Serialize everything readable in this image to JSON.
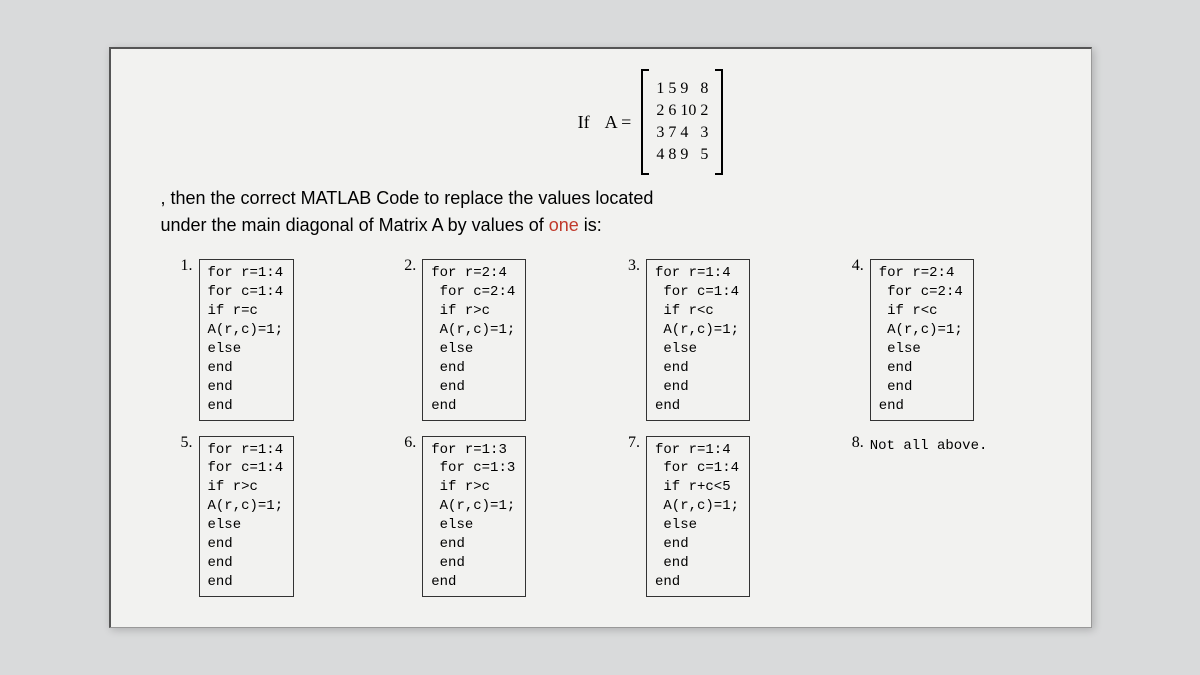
{
  "matrix": {
    "if_label": "If",
    "A_label": "A =",
    "rows": [
      [
        "1",
        "5",
        "9",
        "8"
      ],
      [
        "2",
        "6",
        "10",
        "2"
      ],
      [
        "3",
        "7",
        "4",
        "3"
      ],
      [
        "4",
        "8",
        "9",
        "5"
      ]
    ]
  },
  "question": {
    "line1_prefix": ", then the correct MATLAB Code to replace the values located",
    "line2_prefix": "under the main diagonal of Matrix A by values of ",
    "highlight": "one",
    "line2_suffix": " is:"
  },
  "options": [
    {
      "num": "1.",
      "code": "for r=1:4\nfor c=1:4\nif r=c\nA(r,c)=1;\nelse\nend\nend\nend"
    },
    {
      "num": "2.",
      "code": "for r=2:4\n for c=2:4\n if r>c\n A(r,c)=1;\n else\n end\n end\nend"
    },
    {
      "num": "3.",
      "code": "for r=1:4\n for c=1:4\n if r<c\n A(r,c)=1;\n else\n end\n end\nend"
    },
    {
      "num": "4.",
      "code": "for r=2:4\n for c=2:4\n if r<c\n A(r,c)=1;\n else\n end\n end\nend"
    },
    {
      "num": "5.",
      "code": "for r=1:4\nfor c=1:4\nif r>c\nA(r,c)=1;\nelse\nend\nend\nend"
    },
    {
      "num": "6.",
      "code": "for r=1:3\n for c=1:3\n if r>c\n A(r,c)=1;\n else\n end\n end\nend"
    },
    {
      "num": "7.",
      "code": "for r=1:4\n for c=1:4\n if r+c<5\n A(r,c)=1;\n else\n end\n end\nend"
    },
    {
      "num": "8.",
      "text": "Not all above."
    }
  ]
}
